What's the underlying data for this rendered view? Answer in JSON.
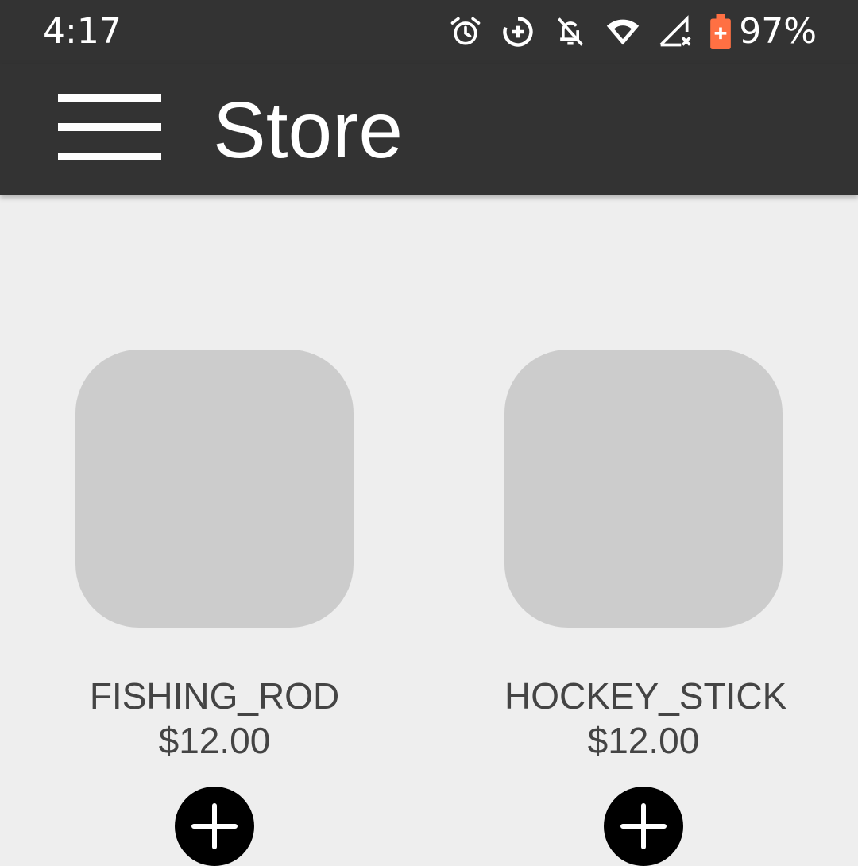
{
  "status_bar": {
    "time": "4:17",
    "battery_percent": "97%",
    "icons": [
      "alarm-icon",
      "data-saver-icon",
      "notifications-off-icon",
      "wifi-icon",
      "signal-no-data-icon",
      "battery-saver-icon"
    ],
    "battery_color": "#ff7043"
  },
  "app_bar": {
    "title": "Store",
    "menu_icon": "menu-icon"
  },
  "products": [
    {
      "name": "FISHING_ROD",
      "price": "$12.00",
      "action_icon": "add-icon"
    },
    {
      "name": "HOCKEY_STICK",
      "price": "$12.00",
      "action_icon": "add-icon"
    }
  ],
  "colors": {
    "bar_background": "#333333",
    "page_background": "#eeeeee",
    "placeholder": "#cccccc",
    "text": "#444444",
    "button": "#000000"
  }
}
